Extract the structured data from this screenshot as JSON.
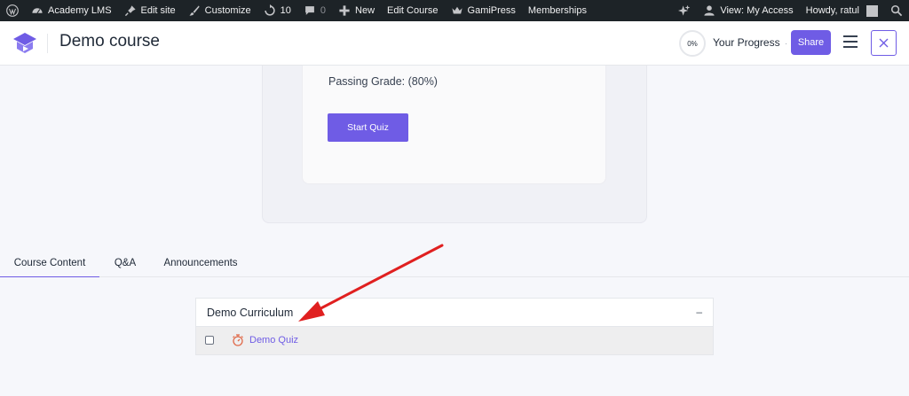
{
  "adminbar": {
    "site_name": "Academy LMS",
    "edit_site": "Edit site",
    "customize": "Customize",
    "updates_count": "10",
    "comments_count": "0",
    "new_label": "New",
    "edit_course": "Edit Course",
    "gamipress": "GamiPress",
    "memberships": "Memberships",
    "view_access": "View: My Access",
    "howdy": "Howdy, ratul"
  },
  "header": {
    "course_title": "Demo course",
    "progress_percent": "0%",
    "progress_label": "Your Progress",
    "progress_dot": "·",
    "share_label": "Share"
  },
  "quiz": {
    "passing_grade": "Passing Grade: (80%)",
    "start_label": "Start Quiz"
  },
  "tabs": [
    {
      "label": "Course Content",
      "active": true
    },
    {
      "label": "Q&A",
      "active": false
    },
    {
      "label": "Announcements",
      "active": false
    }
  ],
  "curriculum": {
    "title": "Demo Curriculum",
    "collapse_symbol": "–",
    "items": [
      {
        "label": "Demo Quiz",
        "type_icon": "quiz-icon",
        "checked": false
      }
    ]
  },
  "colors": {
    "accent": "#6f5ce5",
    "adminbar_bg": "#1d2327",
    "annotation_arrow": "#e02020"
  }
}
